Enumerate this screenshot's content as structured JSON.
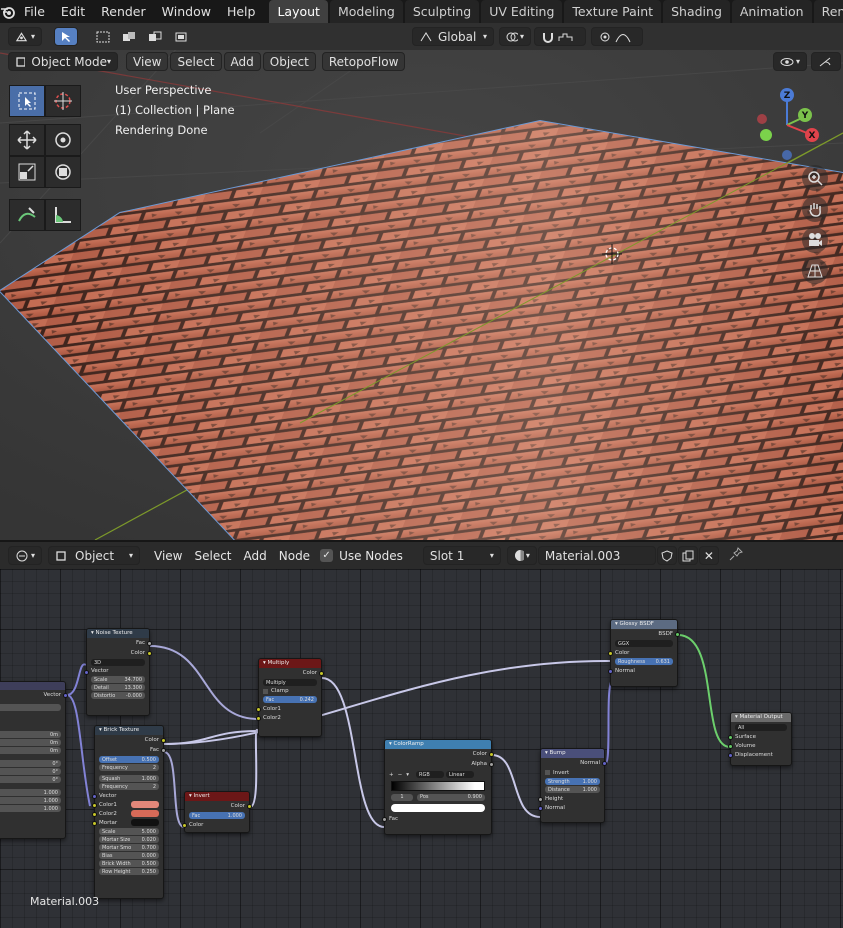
{
  "menubar": {
    "items": [
      "File",
      "Edit",
      "Render",
      "Window",
      "Help"
    ],
    "workspaces": [
      "Layout",
      "Modeling",
      "Sculpting",
      "UV Editing",
      "Texture Paint",
      "Shading",
      "Animation",
      "Renderin"
    ],
    "active_workspace": "Layout"
  },
  "viewport_header": {
    "transform_orientation": "Global",
    "mode": "Object Mode",
    "menus": [
      "View",
      "Select",
      "Add",
      "Object",
      "RetopoFlow"
    ]
  },
  "viewport": {
    "info_line1": "User Perspective",
    "info_line2": "(1) Collection | Plane",
    "info_line3": "Rendering Done",
    "gizmo_axes": {
      "z": "Z",
      "y": "Y",
      "x": "X"
    }
  },
  "node_header": {
    "editor_type": "Object",
    "menus": [
      "View",
      "Select",
      "Add",
      "Node"
    ],
    "use_nodes_label": "Use Nodes",
    "slot": "Slot 1",
    "material": "Material.003"
  },
  "node_editor": {
    "material_label": "Material.003",
    "left_node": {
      "output": "Vector",
      "values": [
        "0m",
        "0m",
        "0m",
        "0°",
        "0°",
        "0°",
        "1.000",
        "1.000",
        "1.000"
      ]
    },
    "noise": {
      "title": "Noise Texture",
      "out_fac": "Fac",
      "out_color": "Color",
      "mode": "3D",
      "vector": "Vector",
      "scale_label": "Scale",
      "scale": "34.700",
      "detail_label": "Detail",
      "detail": "13.300",
      "distortion_label": "Distortio",
      "distortion": "-0.000"
    },
    "brick": {
      "title": "Brick Texture",
      "out_color": "Color",
      "out_fac": "Fac",
      "offset_label": "Offset",
      "offset": "0.500",
      "frequency_label": "Frequency",
      "frequency": "2",
      "squash_label": "Squash",
      "squash": "1.000",
      "frequency2_label": "Frequency",
      "frequency2": "2",
      "vector": "Vector",
      "color1": "Color1",
      "color2": "Color2",
      "mortar": "Mortar",
      "scale_label": "Scale",
      "scale": "5.000",
      "mortar_size_label": "Mortar Size",
      "mortar_size": "0.020",
      "mortar_smooth_label": "Mortar Smo",
      "mortar_smooth": "0.700",
      "bias_label": "Bias",
      "bias": "0.000",
      "brick_width_label": "Brick Width",
      "brick_width": "0.500",
      "row_height_label": "Row Height",
      "row_height": "0.250",
      "color1_hex": "#e2877a",
      "color2_hex": "#d76a58"
    },
    "multiply": {
      "title": "Multiply",
      "out_color": "Color",
      "blend": "Multiply",
      "clamp": "Clamp",
      "fac_label": "Fac",
      "fac": "0.242",
      "color1": "Color1",
      "color2": "Color2"
    },
    "invert": {
      "title": "Invert",
      "out_color": "Color",
      "fac_label": "Fac",
      "fac": "1.000",
      "color": "Color"
    },
    "colorramp": {
      "title": "ColorRamp",
      "out_color": "Color",
      "out_alpha": "Alpha",
      "color_mode": "RGB",
      "interp": "Linear",
      "index": "1",
      "pos_label": "Pos",
      "pos": "0.900",
      "fac": "Fac"
    },
    "bump": {
      "title": "Bump",
      "out_normal": "Normal",
      "invert": "Invert",
      "strength_label": "Strength",
      "strength": "1.000",
      "distance_label": "Distance",
      "distance": "1.000",
      "height": "Height",
      "normal": "Normal"
    },
    "glossy": {
      "title": "Glossy BSDF",
      "out_bsdf": "BSDF",
      "distribution": "GGX",
      "color": "Color",
      "roughness_label": "Roughness",
      "roughness": "0.631",
      "normal": "Normal"
    },
    "output": {
      "title": "Material Output",
      "target": "All",
      "surface": "Surface",
      "volume": "Volume",
      "displacement": "Displacement"
    }
  },
  "colors": {
    "accent_blue": "#4772b3",
    "brick": "#b5634a",
    "color_node_header": "#6c1717",
    "converter_header": "#2b4e72"
  }
}
